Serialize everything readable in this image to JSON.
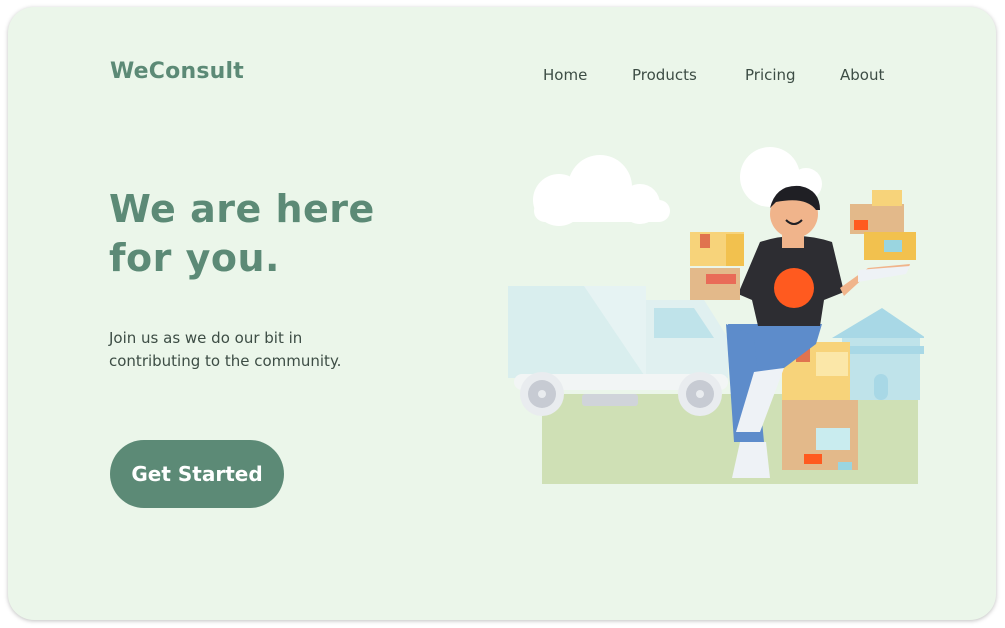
{
  "brand": {
    "name": "WeConsult"
  },
  "nav": {
    "items": [
      {
        "label": "Home"
      },
      {
        "label": "Products"
      },
      {
        "label": "Pricing"
      },
      {
        "label": "About"
      }
    ]
  },
  "hero": {
    "title_line1": "We are here",
    "title_line2": "for you.",
    "subtitle_line1": "Join us as we do our bit in",
    "subtitle_line2": "contributing to the community.",
    "cta_label": "Get Started"
  },
  "colors": {
    "background": "#ebf6ea",
    "accent": "#5c8a76",
    "text": "#3d4d45"
  },
  "illustration": {
    "icons": [
      "cloud-icon",
      "delivery-truck-icon",
      "house-icon",
      "package-icon",
      "delivery-person-icon"
    ]
  }
}
